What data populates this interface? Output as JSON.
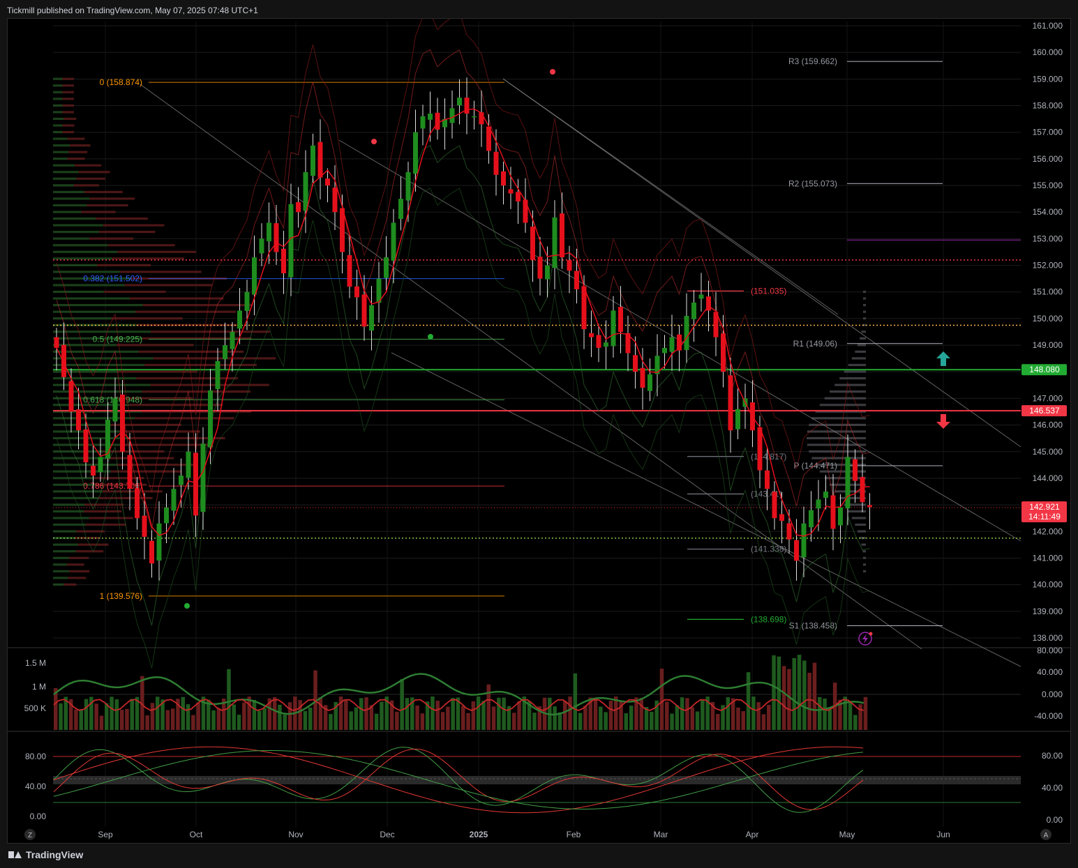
{
  "header": {
    "publisher": "Tickmill published on TradingView.com, May 07, 2025 07:48 UTC+1"
  },
  "footer": {
    "brand": "TradingView"
  },
  "colors": {
    "up": "#1e8c1e",
    "down": "#e5101b",
    "bg": "#000000",
    "grid": "#1c1c1c",
    "resistance": "#f23645",
    "support": "#22ab32",
    "pivot": "#9c27b0"
  },
  "icons": {
    "lightning": "lightning-icon",
    "arrow_up": "arrow-up-icon",
    "arrow_down": "arrow-down-icon"
  },
  "chart_data": [
    {
      "type": "candlestick",
      "y_ticks": [
        "161.000",
        "160.000",
        "159.000",
        "158.000",
        "157.000",
        "156.000",
        "155.000",
        "154.000",
        "153.000",
        "152.000",
        "151.000",
        "150.000",
        "149.000",
        "148.000",
        "147.000",
        "146.000",
        "145.000",
        "144.000",
        "143.000",
        "142.000",
        "141.000",
        "140.000",
        "139.000",
        "138.000"
      ],
      "ylim": [
        137.9,
        161.3
      ],
      "x_ticks": [
        "Sep",
        "Oct",
        "Nov",
        "Dec",
        "2025",
        "Feb",
        "Mar",
        "Apr",
        "May",
        "Jun"
      ],
      "closes": [
        148.9,
        147.8,
        146.5,
        145.8,
        144.6,
        144.1,
        144.8,
        146.2,
        147.0,
        145.0,
        143.6,
        142.5,
        141.8,
        140.8,
        142.3,
        142.9,
        143.6,
        144.1,
        145.0,
        142.6,
        145.3,
        147.3,
        148.4,
        149.0,
        149.5,
        150.3,
        151.0,
        152.3,
        153.0,
        153.6,
        152.5,
        151.7,
        154.3,
        154.0,
        155.5,
        156.5,
        155.3,
        155.0,
        154.0,
        152.5,
        151.2,
        150.8,
        149.7,
        150.5,
        151.5,
        152.3,
        153.6,
        154.5,
        155.5,
        157.0,
        157.6,
        157.7,
        157.1,
        157.5,
        157.9,
        158.3,
        157.7,
        157.6,
        157.3,
        156.3,
        155.4,
        155.0,
        154.7,
        154.4,
        153.6,
        152.2,
        151.5,
        152.0,
        153.8,
        152.3,
        151.8,
        151.1,
        149.6,
        149.3,
        148.9,
        149.1,
        150.3,
        149.5,
        148.7,
        148.0,
        147.4,
        147.9,
        148.6,
        148.9,
        149.3,
        148.8,
        150.1,
        150.6,
        150.9,
        150.3,
        149.3,
        148.0,
        145.8,
        146.6,
        147.0,
        145.8,
        144.3,
        143.6,
        142.5,
        142.4,
        141.7,
        140.9,
        142.3,
        142.8,
        143.2,
        143.5,
        142.1,
        142.9,
        144.8,
        143.9,
        143.1,
        142.92
      ],
      "price_labels": [
        {
          "text": "R3 (159.662)",
          "price": 159.662,
          "color": "#9598a1"
        },
        {
          "text": "R2 (155.073)",
          "price": 155.073,
          "color": "#9598a1"
        },
        {
          "text": "R1 (149.06)",
          "price": 149.06,
          "color": "#9598a1"
        },
        {
          "text": "P (144.471)",
          "price": 144.471,
          "color": "#9598a1"
        },
        {
          "text": "S1 (138.458)",
          "price": 138.458,
          "color": "#9598a1"
        },
        {
          "text": "(151.035)",
          "price": 151.035,
          "color": "#f23645"
        },
        {
          "text": "(144.817)",
          "price": 144.817,
          "color": "#787b86"
        },
        {
          "text": "(143.41)",
          "price": 143.41,
          "color": "#787b86"
        },
        {
          "text": "(141.338)",
          "price": 141.338,
          "color": "#787b86"
        },
        {
          "text": "(138.698)",
          "price": 138.698,
          "color": "#22ab32"
        }
      ],
      "fib_levels": [
        {
          "text": "0 (158.874)",
          "price": 158.874,
          "color": "#ff9800"
        },
        {
          "text": "0.382 (151.502)",
          "price": 151.502,
          "color": "#2962ff"
        },
        {
          "text": "0.5 (149.225)",
          "price": 149.225,
          "color": "#4caf50"
        },
        {
          "text": "0.618 (146.948)",
          "price": 146.948,
          "color": "#4caf50"
        },
        {
          "text": "0.786 (143.706)",
          "price": 143.706,
          "color": "#f23645"
        },
        {
          "text": "1 (139.576)",
          "price": 139.576,
          "color": "#ff9800"
        }
      ],
      "badges": [
        {
          "text": "148.080",
          "price": 148.08,
          "color": "#22ab32"
        },
        {
          "text": "146.537",
          "price": 146.537,
          "color": "#f23645"
        },
        {
          "text": "142.921",
          "price": 142.921,
          "color": "#f23645"
        }
      ],
      "countdown": "14:11:49"
    },
    {
      "type": "bar",
      "y_ticks_left": [
        "1.5 M",
        "1 M",
        "500 K"
      ],
      "y_ticks_right": [
        "80.000",
        "40.000",
        "0.000",
        "-40.000"
      ]
    },
    {
      "type": "line",
      "y_ticks_left": [
        "80.00",
        "40.00",
        "0.00"
      ],
      "y_ticks_right": [
        "80.00",
        "40.00",
        "0.00"
      ]
    }
  ],
  "bottom": {
    "left_btn": "Z",
    "right_btn": "A"
  }
}
